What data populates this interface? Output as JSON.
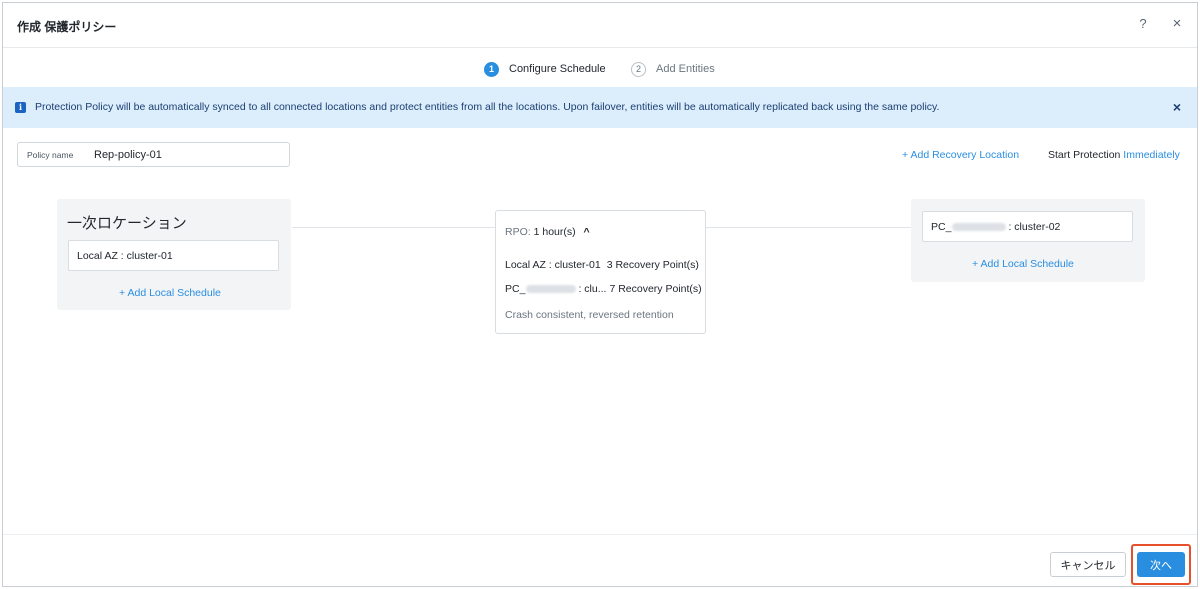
{
  "header": {
    "title": "作成 保護ポリシー",
    "help": "?",
    "close": "×"
  },
  "steps": [
    {
      "num": "1",
      "label": "Configure Schedule",
      "active": true
    },
    {
      "num": "2",
      "label": "Add Entities",
      "active": false
    }
  ],
  "banner": {
    "text": "Protection Policy will be automatically synced to all connected locations and protect entities from all the locations. Upon failover, entities will be automatically replicated back using the same policy.",
    "close": "×"
  },
  "policy": {
    "label": "Policy name",
    "value": "Rep-policy-01"
  },
  "actions": {
    "add_recovery": "+ Add Recovery Location",
    "start_protection": "Start Protection",
    "start_link": "Immediately"
  },
  "primary": {
    "title": "一次ロケーション",
    "cluster": "Local AZ : cluster-01",
    "add_schedule": "+ Add Local Schedule"
  },
  "recovery": {
    "cluster_prefix": "PC_",
    "cluster_suffix": ": cluster-02",
    "add_schedule": "+ Add Local Schedule"
  },
  "rpo": {
    "label": "RPO:",
    "value": "1 hour(s)",
    "chevron": "^",
    "rows": [
      {
        "name": "Local AZ : cluster-01",
        "points": "3 Recovery Point(s)"
      },
      {
        "name_prefix": "PC_",
        "name_suffix": ": clu...",
        "points": "7 Recovery Point(s)"
      }
    ],
    "footer": "Crash consistent, reversed retention"
  },
  "footer": {
    "cancel": "キャンセル",
    "next": "次へ"
  },
  "colors": {
    "accent": "#2a8ee0",
    "highlight": "#e8502b",
    "banner_bg": "#dcedfb"
  }
}
